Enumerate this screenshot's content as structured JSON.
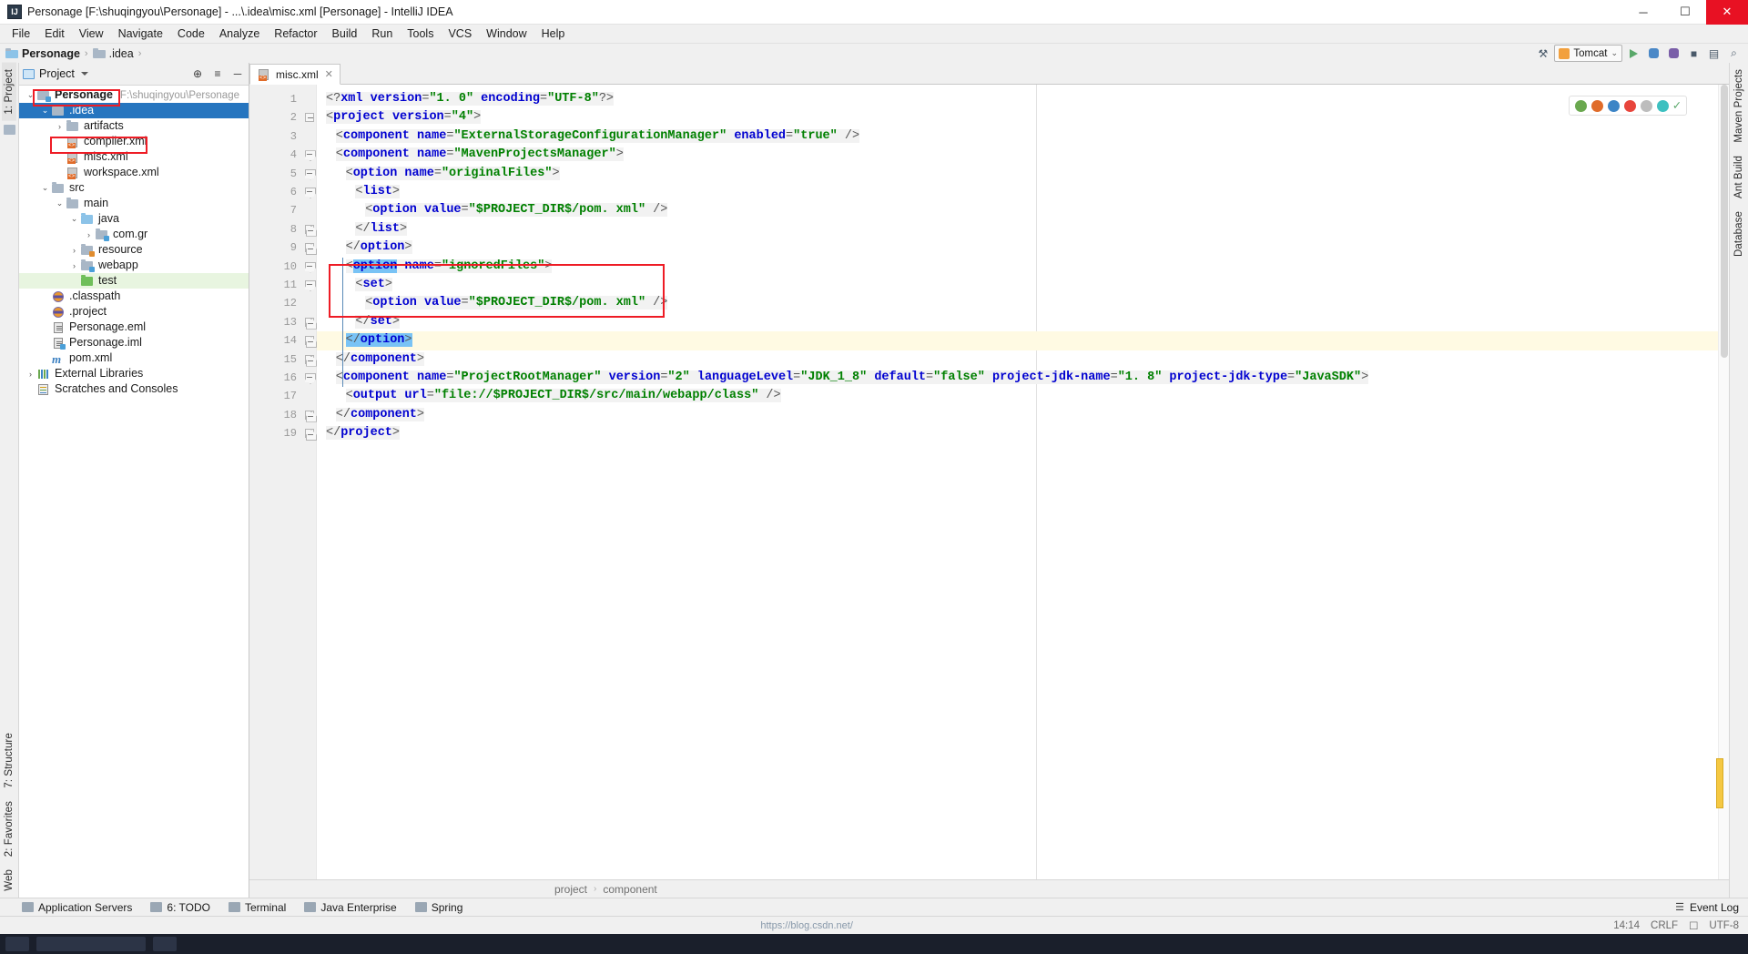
{
  "window": {
    "title": "Personage [F:\\shuqingyou\\Personage] - ...\\.idea\\misc.xml [Personage] - IntelliJ IDEA",
    "logo": "IJ",
    "minimize": "─",
    "maximize": "☐",
    "close": "✕"
  },
  "menu": {
    "items": [
      {
        "label": "File"
      },
      {
        "label": "Edit"
      },
      {
        "label": "View"
      },
      {
        "label": "Navigate"
      },
      {
        "label": "Code"
      },
      {
        "label": "Analyze"
      },
      {
        "label": "Refactor"
      },
      {
        "label": "Build"
      },
      {
        "label": "Run"
      },
      {
        "label": "Tools"
      },
      {
        "label": "VCS"
      },
      {
        "label": "Window"
      },
      {
        "label": "Help"
      }
    ]
  },
  "navbar": {
    "crumbs": [
      {
        "label": "Personage",
        "icon": "folder-icon"
      },
      {
        "label": ".idea",
        "icon": "folder-icon"
      }
    ],
    "separator": "›",
    "run_config": "Tomcat",
    "chevron": "⌄",
    "hammer_icon": "⚒",
    "run_icon": "run-icon",
    "debug_icon": "debug-icon",
    "coverage_icon": "coverage-icon",
    "stop_icon": "■",
    "layout_icon": "▤",
    "search_icon": "⌕"
  },
  "left_strip": {
    "project_tab": "1: Project",
    "structure_tab": "7: Structure",
    "favorites_tab": "2: Favorites",
    "web_tab": "Web"
  },
  "right_strip": {
    "maven_tab": "Maven Projects",
    "ant_tab": "Ant Build",
    "database_tab": "Database"
  },
  "project_panel": {
    "title": "Project",
    "caret": "▾",
    "action_target": "⊕",
    "action_collapse": "≡",
    "action_minimize": "─",
    "tree": [
      {
        "label": "Personage",
        "path": "F:\\shuqingyou\\Personage",
        "arrow": "⌄",
        "indent": 0,
        "icon": "folder-module-icon",
        "bold": true
      },
      {
        "label": ".idea",
        "arrow": "⌄",
        "indent": 1,
        "icon": "folder-icon",
        "selected": true,
        "boxed": true
      },
      {
        "label": "artifacts",
        "arrow": "›",
        "indent": 2,
        "icon": "folder-icon"
      },
      {
        "label": "compiler.xml",
        "arrow": "",
        "indent": 2,
        "icon": "xml-file-icon"
      },
      {
        "label": "misc.xml",
        "arrow": "",
        "indent": 2,
        "icon": "xml-file-icon",
        "boxed": true
      },
      {
        "label": "workspace.xml",
        "arrow": "",
        "indent": 2,
        "icon": "xml-file-icon"
      },
      {
        "label": "src",
        "arrow": "⌄",
        "indent": 1,
        "icon": "folder-icon"
      },
      {
        "label": "main",
        "arrow": "⌄",
        "indent": 2,
        "icon": "folder-icon"
      },
      {
        "label": "java",
        "arrow": "⌄",
        "indent": 3,
        "icon": "folder-source-icon"
      },
      {
        "label": "com.gr",
        "arrow": "›",
        "indent": 4,
        "icon": "package-icon"
      },
      {
        "label": "resource",
        "arrow": "›",
        "indent": 3,
        "icon": "folder-resource-icon"
      },
      {
        "label": "webapp",
        "arrow": "›",
        "indent": 3,
        "icon": "folder-web-icon"
      },
      {
        "label": "test",
        "arrow": "",
        "indent": 3,
        "icon": "folder-test-icon",
        "green": true
      },
      {
        "label": ".classpath",
        "arrow": "",
        "indent": 1,
        "icon": "globe-file-icon"
      },
      {
        "label": ".project",
        "arrow": "",
        "indent": 1,
        "icon": "globe-file-icon"
      },
      {
        "label": "Personage.eml",
        "arrow": "",
        "indent": 1,
        "icon": "doc-file-icon"
      },
      {
        "label": "Personage.iml",
        "arrow": "",
        "indent": 1,
        "icon": "module-file-icon"
      },
      {
        "label": "pom.xml",
        "arrow": "",
        "indent": 1,
        "icon": "maven-file-icon"
      },
      {
        "label": "External Libraries",
        "arrow": "›",
        "indent": 0,
        "icon": "libraries-icon"
      },
      {
        "label": "Scratches and Consoles",
        "arrow": "",
        "indent": 0,
        "icon": "scratches-icon"
      }
    ]
  },
  "editor": {
    "tab": {
      "label": "misc.xml",
      "icon": "xml-file-icon",
      "close": "✕"
    },
    "caret_line": 14,
    "lines": [
      {
        "n": 1,
        "fold": "",
        "indent": 0,
        "tokens": [
          {
            "t": "<?",
            "c": "br"
          },
          {
            "t": "xml",
            "c": "tg"
          },
          {
            "t": " ",
            "c": "br"
          },
          {
            "t": "version",
            "c": "at"
          },
          {
            "t": "=",
            "c": "br"
          },
          {
            "t": "\"1. 0\"",
            "c": "vl"
          },
          {
            "t": " ",
            "c": "br"
          },
          {
            "t": "encoding",
            "c": "at"
          },
          {
            "t": "=",
            "c": "br"
          },
          {
            "t": "\"UTF-8\"",
            "c": "vl"
          },
          {
            "t": "?>",
            "c": "br"
          }
        ]
      },
      {
        "n": 2,
        "fold": "sq",
        "indent": 0,
        "tokens": [
          {
            "t": "<",
            "c": "br"
          },
          {
            "t": "project",
            "c": "tg"
          },
          {
            "t": " ",
            "c": "br"
          },
          {
            "t": "version",
            "c": "at"
          },
          {
            "t": "=",
            "c": "br"
          },
          {
            "t": "\"4\"",
            "c": "vl"
          },
          {
            "t": ">",
            "c": "br"
          }
        ]
      },
      {
        "n": 3,
        "fold": "",
        "indent": 1,
        "tokens": [
          {
            "t": "<",
            "c": "br"
          },
          {
            "t": "component",
            "c": "tg"
          },
          {
            "t": " ",
            "c": "br"
          },
          {
            "t": "name",
            "c": "at"
          },
          {
            "t": "=",
            "c": "br"
          },
          {
            "t": "\"ExternalStorageConfigurationManager\"",
            "c": "vl"
          },
          {
            "t": " ",
            "c": "br"
          },
          {
            "t": "enabled",
            "c": "at"
          },
          {
            "t": "=",
            "c": "br"
          },
          {
            "t": "\"true\"",
            "c": "vl"
          },
          {
            "t": " />",
            "c": "br"
          }
        ]
      },
      {
        "n": 4,
        "fold": "down",
        "indent": 1,
        "tokens": [
          {
            "t": "<",
            "c": "br"
          },
          {
            "t": "component",
            "c": "tg"
          },
          {
            "t": " ",
            "c": "br"
          },
          {
            "t": "name",
            "c": "at"
          },
          {
            "t": "=",
            "c": "br"
          },
          {
            "t": "\"MavenProjectsManager\"",
            "c": "vl"
          },
          {
            "t": ">",
            "c": "br"
          }
        ]
      },
      {
        "n": 5,
        "fold": "down",
        "indent": 2,
        "tokens": [
          {
            "t": "<",
            "c": "br"
          },
          {
            "t": "option",
            "c": "tg"
          },
          {
            "t": " ",
            "c": "br"
          },
          {
            "t": "name",
            "c": "at"
          },
          {
            "t": "=",
            "c": "br"
          },
          {
            "t": "\"originalFiles\"",
            "c": "vl"
          },
          {
            "t": ">",
            "c": "br"
          }
        ]
      },
      {
        "n": 6,
        "fold": "down",
        "indent": 3,
        "tokens": [
          {
            "t": "<",
            "c": "br"
          },
          {
            "t": "list",
            "c": "tg"
          },
          {
            "t": ">",
            "c": "br"
          }
        ]
      },
      {
        "n": 7,
        "fold": "",
        "indent": 4,
        "tokens": [
          {
            "t": "<",
            "c": "br"
          },
          {
            "t": "option",
            "c": "tg"
          },
          {
            "t": " ",
            "c": "br"
          },
          {
            "t": "value",
            "c": "at"
          },
          {
            "t": "=",
            "c": "br"
          },
          {
            "t": "\"$PROJECT_DIR$/pom. xml\"",
            "c": "vl"
          },
          {
            "t": " />",
            "c": "br"
          }
        ]
      },
      {
        "n": 8,
        "fold": "up",
        "indent": 3,
        "tokens": [
          {
            "t": "</",
            "c": "br"
          },
          {
            "t": "list",
            "c": "tg"
          },
          {
            "t": ">",
            "c": "br"
          }
        ]
      },
      {
        "n": 9,
        "fold": "up",
        "indent": 2,
        "tokens": [
          {
            "t": "</",
            "c": "br"
          },
          {
            "t": "option",
            "c": "tg"
          },
          {
            "t": ">",
            "c": "br"
          }
        ]
      },
      {
        "n": 10,
        "fold": "down",
        "indent": 2,
        "tokens": [
          {
            "t": "<",
            "c": "br"
          },
          {
            "t": "option",
            "c": "tg sel"
          },
          {
            "t": " ",
            "c": "br"
          },
          {
            "t": "name",
            "c": "at"
          },
          {
            "t": "=",
            "c": "br"
          },
          {
            "t": "\"ignoredFiles\"",
            "c": "vl"
          },
          {
            "t": ">",
            "c": "br"
          }
        ]
      },
      {
        "n": 11,
        "fold": "down",
        "indent": 3,
        "tokens": [
          {
            "t": "<",
            "c": "br"
          },
          {
            "t": "set",
            "c": "tg"
          },
          {
            "t": ">",
            "c": "br"
          }
        ]
      },
      {
        "n": 12,
        "fold": "",
        "indent": 4,
        "tokens": [
          {
            "t": "<",
            "c": "br"
          },
          {
            "t": "option",
            "c": "tg"
          },
          {
            "t": " ",
            "c": "br"
          },
          {
            "t": "value",
            "c": "at"
          },
          {
            "t": "=",
            "c": "br"
          },
          {
            "t": "\"$PROJECT_DIR$/pom. xml\"",
            "c": "vl"
          },
          {
            "t": " />",
            "c": "br"
          }
        ]
      },
      {
        "n": 13,
        "fold": "up",
        "indent": 3,
        "tokens": [
          {
            "t": "</",
            "c": "br"
          },
          {
            "t": "set",
            "c": "tg"
          },
          {
            "t": ">",
            "c": "br"
          }
        ]
      },
      {
        "n": 14,
        "fold": "up",
        "indent": 2,
        "tokens": [
          {
            "t": "</",
            "c": "br sel"
          },
          {
            "t": "option",
            "c": "tg sel"
          },
          {
            "t": ">",
            "c": "br sel"
          }
        ]
      },
      {
        "n": 15,
        "fold": "up",
        "indent": 1,
        "tokens": [
          {
            "t": "</",
            "c": "br"
          },
          {
            "t": "component",
            "c": "tg"
          },
          {
            "t": ">",
            "c": "br"
          }
        ]
      },
      {
        "n": 16,
        "fold": "down",
        "indent": 1,
        "tokens": [
          {
            "t": "<",
            "c": "br"
          },
          {
            "t": "component",
            "c": "tg"
          },
          {
            "t": " ",
            "c": "br"
          },
          {
            "t": "name",
            "c": "at"
          },
          {
            "t": "=",
            "c": "br"
          },
          {
            "t": "\"ProjectRootManager\"",
            "c": "vl"
          },
          {
            "t": " ",
            "c": "br"
          },
          {
            "t": "version",
            "c": "at"
          },
          {
            "t": "=",
            "c": "br"
          },
          {
            "t": "\"2\"",
            "c": "vl"
          },
          {
            "t": " ",
            "c": "br"
          },
          {
            "t": "languageLevel",
            "c": "at"
          },
          {
            "t": "=",
            "c": "br"
          },
          {
            "t": "\"JDK_1_8\"",
            "c": "vl"
          },
          {
            "t": " ",
            "c": "br"
          },
          {
            "t": "default",
            "c": "at"
          },
          {
            "t": "=",
            "c": "br"
          },
          {
            "t": "\"false\"",
            "c": "vl"
          },
          {
            "t": " ",
            "c": "br"
          },
          {
            "t": "project-jdk-name",
            "c": "at"
          },
          {
            "t": "=",
            "c": "br"
          },
          {
            "t": "\"1. 8\"",
            "c": "vl"
          },
          {
            "t": " ",
            "c": "br"
          },
          {
            "t": "project-jdk-type",
            "c": "at"
          },
          {
            "t": "=",
            "c": "br"
          },
          {
            "t": "\"JavaSDK\"",
            "c": "vl"
          },
          {
            "t": ">",
            "c": "br"
          }
        ]
      },
      {
        "n": 17,
        "fold": "",
        "indent": 2,
        "tokens": [
          {
            "t": "<",
            "c": "br"
          },
          {
            "t": "output",
            "c": "tg"
          },
          {
            "t": " ",
            "c": "br"
          },
          {
            "t": "url",
            "c": "at"
          },
          {
            "t": "=",
            "c": "br"
          },
          {
            "t": "\"file://$PROJECT_DIR$/src/main/webapp/class\"",
            "c": "vl"
          },
          {
            "t": " />",
            "c": "br"
          }
        ]
      },
      {
        "n": 18,
        "fold": "up",
        "indent": 1,
        "tokens": [
          {
            "t": "</",
            "c": "br"
          },
          {
            "t": "component",
            "c": "tg"
          },
          {
            "t": ">",
            "c": "br"
          }
        ]
      },
      {
        "n": 19,
        "fold": "up",
        "indent": 0,
        "tokens": [
          {
            "t": "</",
            "c": "br"
          },
          {
            "t": "project",
            "c": "tg"
          },
          {
            "t": ">",
            "c": "br"
          }
        ]
      }
    ],
    "inspection_dots": [
      "#6aa84f",
      "#e06c2a",
      "#3d85c6",
      "#e8453c",
      "#bdbdbd",
      "#3dc0c0"
    ],
    "inspection_check": "✓"
  },
  "annotations": {
    "boxes": [
      {
        "name": "idea-folder-highlight"
      },
      {
        "name": "misc-xml-highlight"
      },
      {
        "name": "set-block-highlight"
      }
    ],
    "color": "#ee1c25"
  },
  "breadcrumbs": {
    "items": [
      "project",
      "component"
    ],
    "separator": "›"
  },
  "toolwindows": {
    "items": [
      {
        "label": "Application Servers",
        "icon": "server-icon"
      },
      {
        "label": "6: TODO",
        "icon": "todo-icon"
      },
      {
        "label": "Terminal",
        "icon": "terminal-icon"
      },
      {
        "label": "Java Enterprise",
        "icon": "java-enterprise-icon"
      },
      {
        "label": "Spring",
        "icon": "spring-icon"
      }
    ],
    "event_log": "Event Log",
    "event_log_icon": "☰"
  },
  "statusbar": {
    "time": "14:14",
    "line_sep": "CRLF",
    "encoding": "UTF-8",
    "lock_icon": "☐",
    "watermark": "https://blog.csdn.net/"
  }
}
